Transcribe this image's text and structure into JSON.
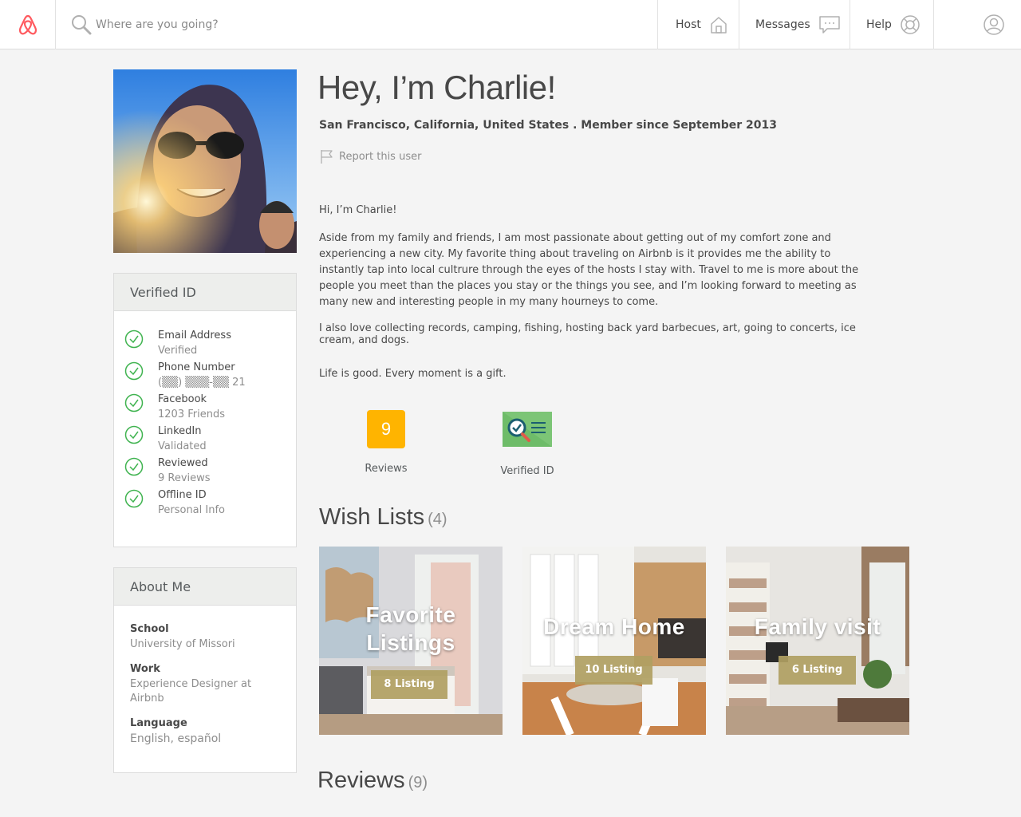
{
  "header": {
    "search_placeholder": "Where are you going?",
    "nav": {
      "host": "Host",
      "messages": "Messages",
      "help": "Help"
    }
  },
  "profile": {
    "title": "Hey, I’m Charlie!",
    "subtitle": "San Francisco, California, United States . Member since September 2013",
    "report": "Report this user",
    "bio": [
      "Hi, I’m Charlie!",
      "Aside from my family and friends, I am most passionate about getting out of my comfort zone and experiencing a new city. My favorite thing about traveling on Airbnb is it provides me the ability to instantly tap into local cultrure through the eyes of the hosts I stay with. Travel to me is more about the people you meet than the places you stay or the things you see, and I’m looking forward to meeting as many new and interesting people in my many hourneys to  come.",
      "I also love collecting records, camping, fishing, hosting back yard barbecues, art, going to concerts, ice cream, and dogs.",
      "Life is good. Every moment is a gift."
    ]
  },
  "verified": {
    "heading": "Verified ID",
    "items": [
      {
        "title": "Email Address",
        "detail": "Verified"
      },
      {
        "title": "Phone Number",
        "detail": "(▒▒) ▒▒▒-▒▒ 21"
      },
      {
        "title": "Facebook",
        "detail": "1203 Friends"
      },
      {
        "title": "LinkedIn",
        "detail": "Validated"
      },
      {
        "title": "Reviewed",
        "detail": "9 Reviews"
      },
      {
        "title": "Offline ID",
        "detail": "Personal Info"
      }
    ]
  },
  "about": {
    "heading": "About Me",
    "rows": [
      {
        "key": "School",
        "value": "University of Missori"
      },
      {
        "key": "Work",
        "value": "Experience Designer at Airbnb"
      },
      {
        "key": "Language",
        "value": "English, español"
      }
    ]
  },
  "badges": {
    "reviews_count": "9",
    "reviews_label": "Reviews",
    "verified_label": "Verified ID"
  },
  "wishlists": {
    "title": "Wish Lists",
    "count": "(4)",
    "items": [
      {
        "name": "Favorite Listings",
        "button": "8 Listing"
      },
      {
        "name": "Dream Home",
        "button": "10 Listing"
      },
      {
        "name": "Family visit",
        "button": "6 Listing"
      }
    ]
  },
  "reviews_section": {
    "title": "Reviews",
    "count": "(9)"
  },
  "colors": {
    "brand": "#ff5a5f",
    "check": "#3fb34f",
    "badge": "#ffb400",
    "listing_button": "#b0a062"
  }
}
